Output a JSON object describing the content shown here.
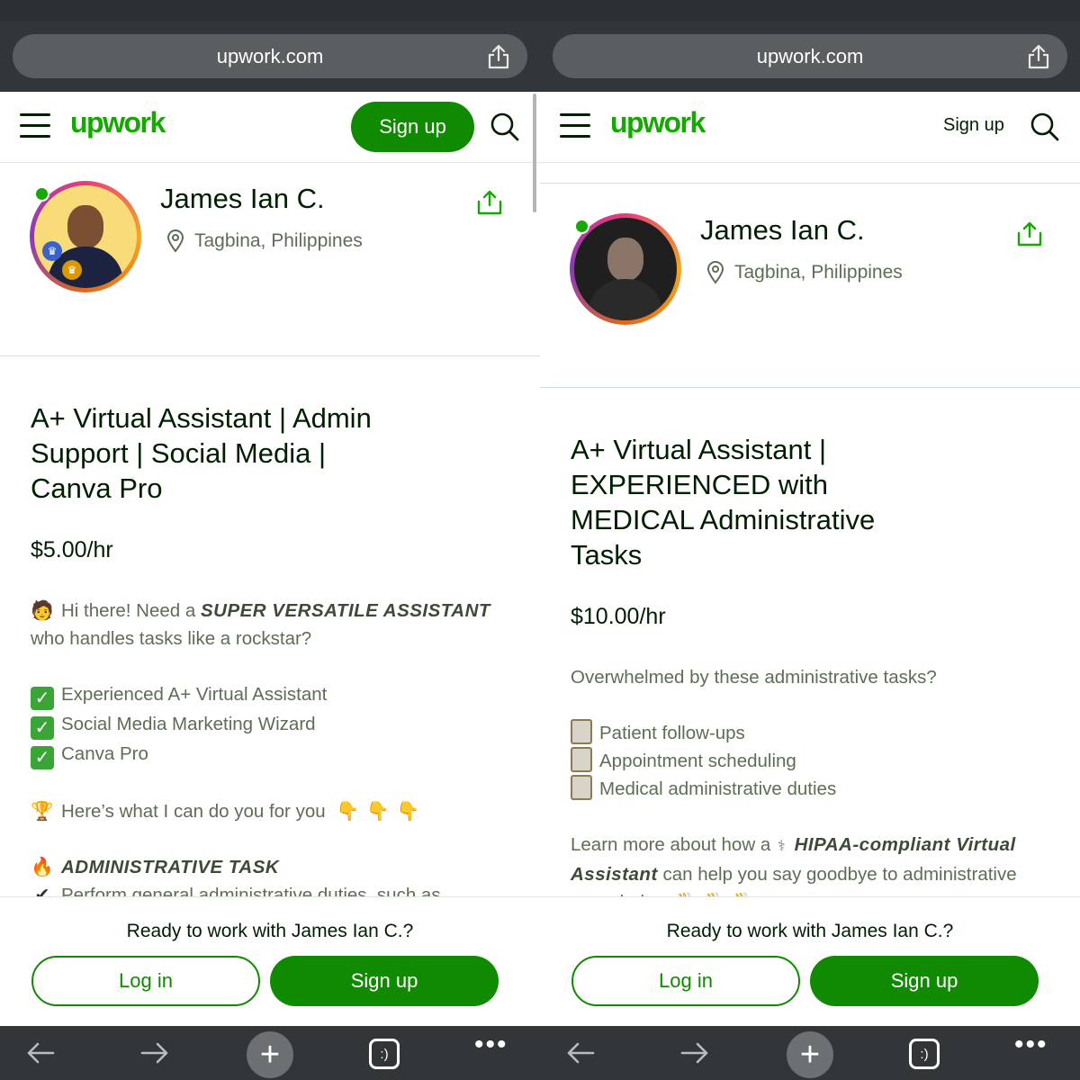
{
  "left": {
    "browser": {
      "url": "upwork.com"
    },
    "header": {
      "logo": "upwork",
      "signup_label": "Sign up"
    },
    "profile": {
      "name": "James Ian C.",
      "location": "Tagbina, Philippines"
    },
    "headline": [
      "A+ Virtual Assistant | Admin",
      "Support | Social Media |",
      "Canva Pro"
    ],
    "rate": "$5.00/hr",
    "desc": {
      "intro_a": "Hi there! Need a ",
      "intro_b": "SUPER VERSATILE ASSISTANT",
      "intro_c": "who handles tasks like a rockstar?",
      "checks": [
        "Experienced A+ Virtual Assistant",
        "Social Media Marketing Wizard",
        "Canva Pro"
      ],
      "cando": "Here’s what I can do you for you",
      "admin": "ADMINISTRATIVE TASK",
      "perform": "Perform general administrative duties, such as"
    },
    "cta": {
      "title": "Ready to work with James Ian C.?",
      "login": "Log in",
      "signup": "Sign up"
    },
    "bottom": {
      "tabs": ":)",
      "more": "•••"
    }
  },
  "right": {
    "browser": {
      "url": "upwork.com"
    },
    "header": {
      "logo": "upwork",
      "signup_label": "Sign up"
    },
    "profile": {
      "name": "James Ian C.",
      "location": "Tagbina, Philippines"
    },
    "headline": [
      "A+ Virtual Assistant |",
      "EXPERIENCED with",
      "MEDICAL Administrative",
      "Tasks"
    ],
    "rate": "$10.00/hr",
    "desc": {
      "question": "Overwhelmed by these administrative tasks?",
      "items": [
        "Patient follow-ups",
        "Appointment scheduling",
        "Medical administrative duties"
      ],
      "learn_a": "Learn more about how a ",
      "learn_b": "HIPAA-compliant Virtual",
      "learn_c": "Assistant",
      "learn_d": " can help you say goodbye to administrative",
      "learn_e": "overwhelm"
    },
    "cta": {
      "title": "Ready to work with James Ian C.?",
      "login": "Log in",
      "signup": "Sign up"
    },
    "bottom": {
      "tabs": ":)",
      "more": "•••"
    }
  },
  "colors": {
    "brand_green": "#14a800",
    "button_green": "#108a00",
    "browser_chrome": "#333638",
    "url_pill": "#5b5e61"
  },
  "icons": [
    "share-icon",
    "menu-icon",
    "search-icon",
    "location-pin-icon",
    "back-arrow-icon",
    "forward-arrow-icon",
    "plus-icon",
    "tabs-icon",
    "more-icon"
  ]
}
